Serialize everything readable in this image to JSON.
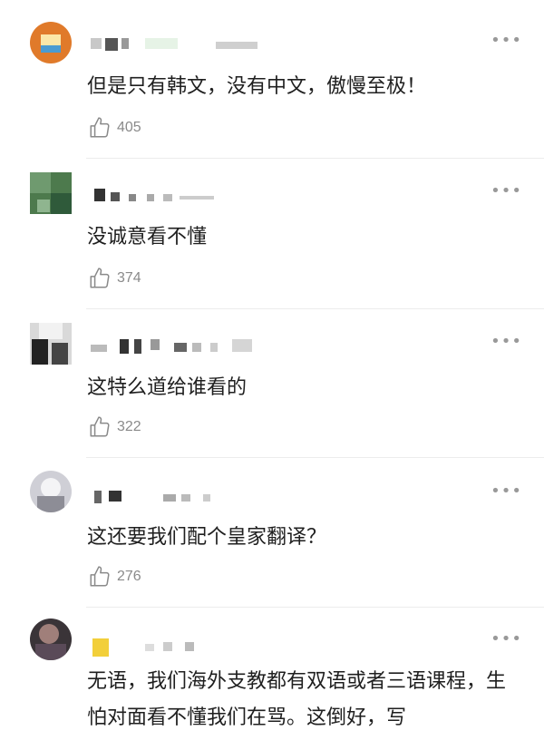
{
  "comments": [
    {
      "text": "但是只有韩文，没有中文，傲慢至极！",
      "likes": "405"
    },
    {
      "text": "没诚意看不懂",
      "likes": "374"
    },
    {
      "text": "这特么道给谁看的",
      "likes": "322"
    },
    {
      "text": "这还要我们配个皇家翻译？",
      "likes": "276"
    },
    {
      "text": "无语，我们海外支教都有双语或者三语课程，生怕对面看不懂我们在骂。这倒好，写",
      "likes": ""
    }
  ],
  "icons": {
    "like": "thumbs-up-icon",
    "more": "more-dots-icon"
  },
  "colors": {
    "text": "#1f1f1f",
    "meta": "#8a8a8a",
    "divider": "#ececec"
  }
}
